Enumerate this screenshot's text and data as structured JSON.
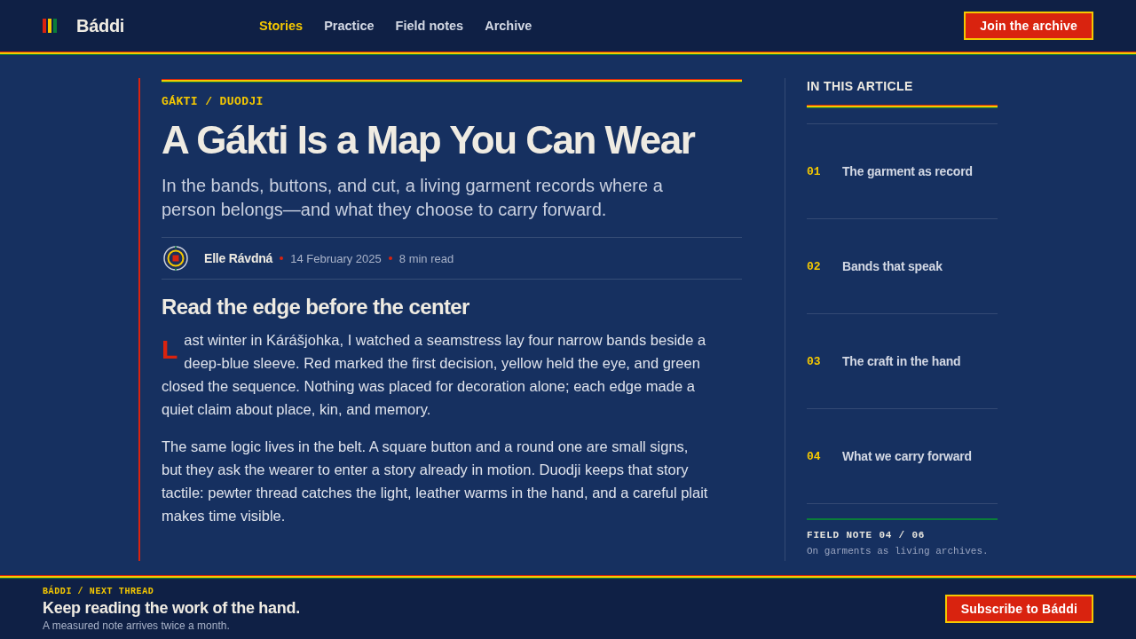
{
  "header": {
    "logo": "Báddi",
    "nav": [
      {
        "label": "Stories",
        "selected": true
      },
      {
        "label": "Practice",
        "selected": false
      },
      {
        "label": "Field notes",
        "selected": false
      },
      {
        "label": "Archive",
        "selected": false
      }
    ],
    "cta": "Join the archive"
  },
  "article": {
    "category": "GÁKTI / DUODJI",
    "title": "A Gákti Is a Map You Can Wear",
    "dek": "In the bands, buttons, and cut, a living garment records where a person belongs—and what they choose to carry forward.",
    "meta": {
      "author": "Elle Rávdná",
      "date": "14 February 2025",
      "read_time": "8 min read"
    },
    "section_heading": "Read the edge before the center",
    "paragraphs": [
      {
        "text": "Last winter in Kárášjohka, I watched a seamstress lay four narrow bands beside a deep-blue sleeve. Red marked the first decision, yellow held the eye, and green closed the sequence. Nothing was placed for decoration alone; each edge made a quiet claim about place, kin, and memory.",
        "drop_cap": true
      },
      {
        "text": "The same logic lives in the belt. A square button and a round one are small signs, but they ask the wearer to enter a story already in motion. Duodji keeps that story tactile: pewter thread catches the light, leather warms in the hand, and a careful plait makes time visible.",
        "drop_cap": false
      }
    ]
  },
  "sidebar": {
    "heading": "IN THIS ARTICLE",
    "toc": [
      {
        "number": "01",
        "title": "The garment as record"
      },
      {
        "number": "02",
        "title": "Bands that speak"
      },
      {
        "number": "03",
        "title": "The craft in the hand"
      },
      {
        "number": "04",
        "title": "What we carry forward"
      }
    ],
    "note": {
      "label": "FIELD NOTE 04 / 06",
      "text": "On garments as living archives."
    }
  },
  "footer": {
    "eyebrow": "BÁDDI / NEXT THREAD",
    "title": "Keep reading the work of the hand.",
    "text": "A measured note arrives twice a month.",
    "cta": "Subscribe to Báddi"
  }
}
